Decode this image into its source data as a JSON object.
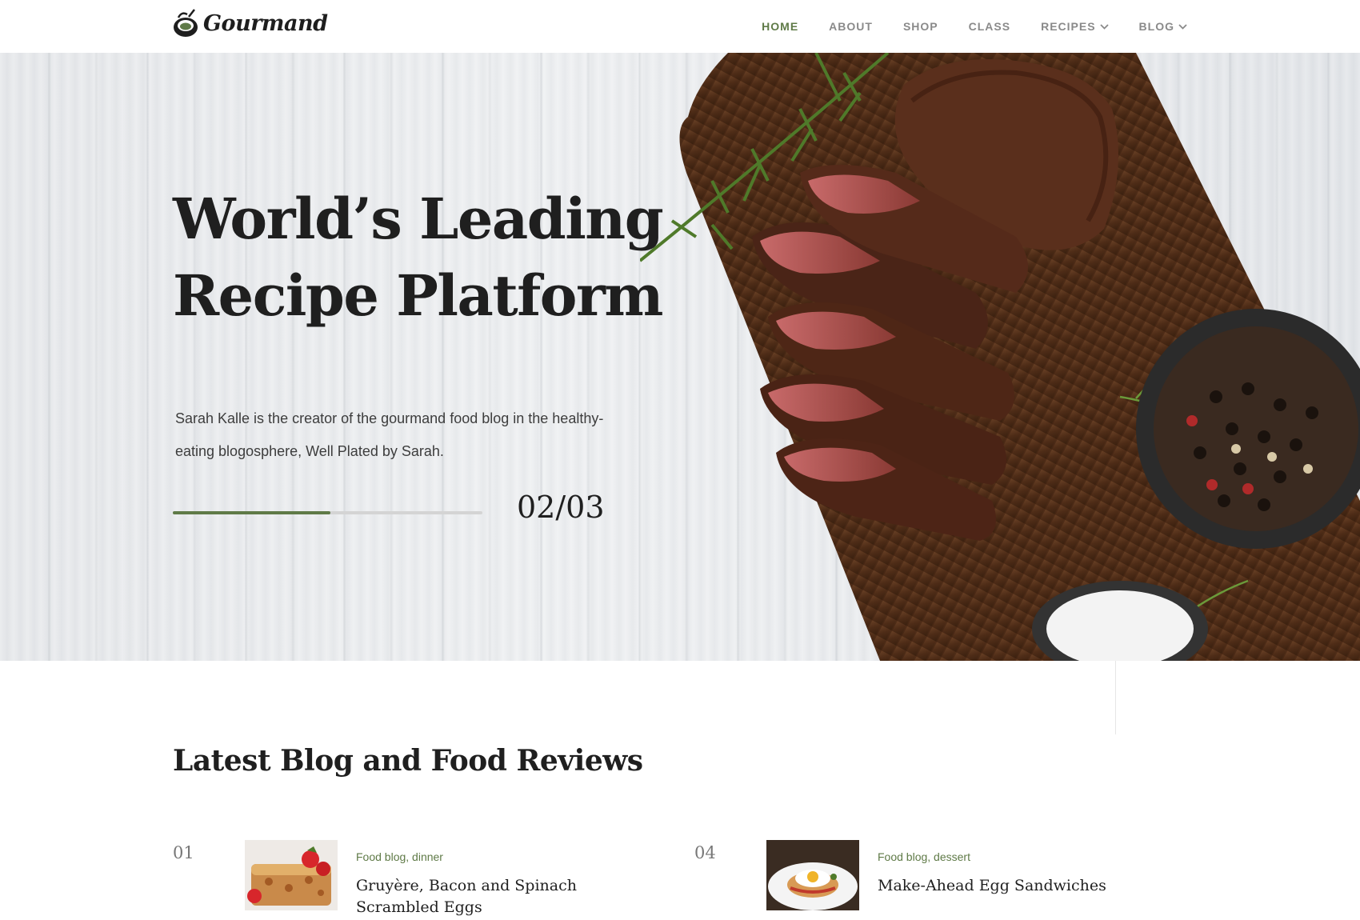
{
  "brand": {
    "name": "Gourmand",
    "accent": "#5f7a47"
  },
  "nav": {
    "items": [
      {
        "label": "HOME",
        "active": true,
        "dropdown": false
      },
      {
        "label": "ABOUT",
        "active": false,
        "dropdown": false
      },
      {
        "label": "SHOP",
        "active": false,
        "dropdown": false
      },
      {
        "label": "CLASS",
        "active": false,
        "dropdown": false
      },
      {
        "label": "RECIPES",
        "active": false,
        "dropdown": true
      },
      {
        "label": "BLOG",
        "active": false,
        "dropdown": true
      }
    ]
  },
  "hero": {
    "title_line1": "World’s Leading",
    "title_line2": "Recipe Platform",
    "description": "Sarah Kalle is the creator of the gourmand food blog in the healthy-eating blogosphere, Well Plated by Sarah.",
    "slide_counter": "02/03",
    "progress_fraction": 0.51,
    "image_icon": "steak-on-cutting-board-image"
  },
  "blog": {
    "heading": "Latest Blog and Food Reviews",
    "posts": [
      {
        "number": "01",
        "categories": "Food blog, dinner",
        "title": "Gruyère, Bacon and Spinach Scrambled Eggs",
        "thumb_icon": "pastry-with-strawberries-image"
      },
      {
        "number": "04",
        "categories": "Food blog, dessert",
        "title": "Make-Ahead Egg Sandwiches",
        "thumb_icon": "egg-sandwich-plate-image"
      }
    ]
  }
}
